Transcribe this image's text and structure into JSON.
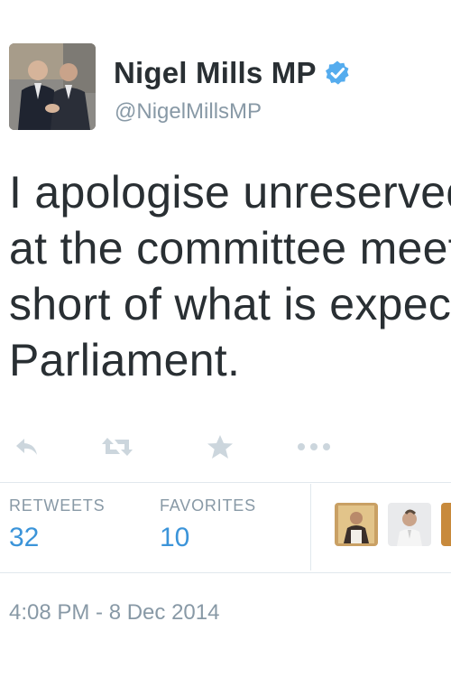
{
  "user": {
    "name": "Nigel Mills MP",
    "handle": "@NigelMillsMP"
  },
  "tweet": {
    "lines": [
      "I apologise unreservedly",
      "at the committee meeting",
      "short of what is expected",
      "Parliament."
    ]
  },
  "actions": {
    "icons": [
      "reply-icon",
      "retweet-icon",
      "favorite-icon",
      "more-icon"
    ]
  },
  "stats": {
    "retweets_label": "RETWEETS",
    "retweets_count": "32",
    "favorites_label": "FAVORITES",
    "favorites_count": "10"
  },
  "timestamp": "4:08 PM - 8 Dec 2014",
  "colors": {
    "text": "#292f33",
    "muted": "#8899a6",
    "link": "#3b94d9",
    "verified": "#55acee",
    "icon": "#ccd6dd",
    "border": "#e1e8ed"
  }
}
